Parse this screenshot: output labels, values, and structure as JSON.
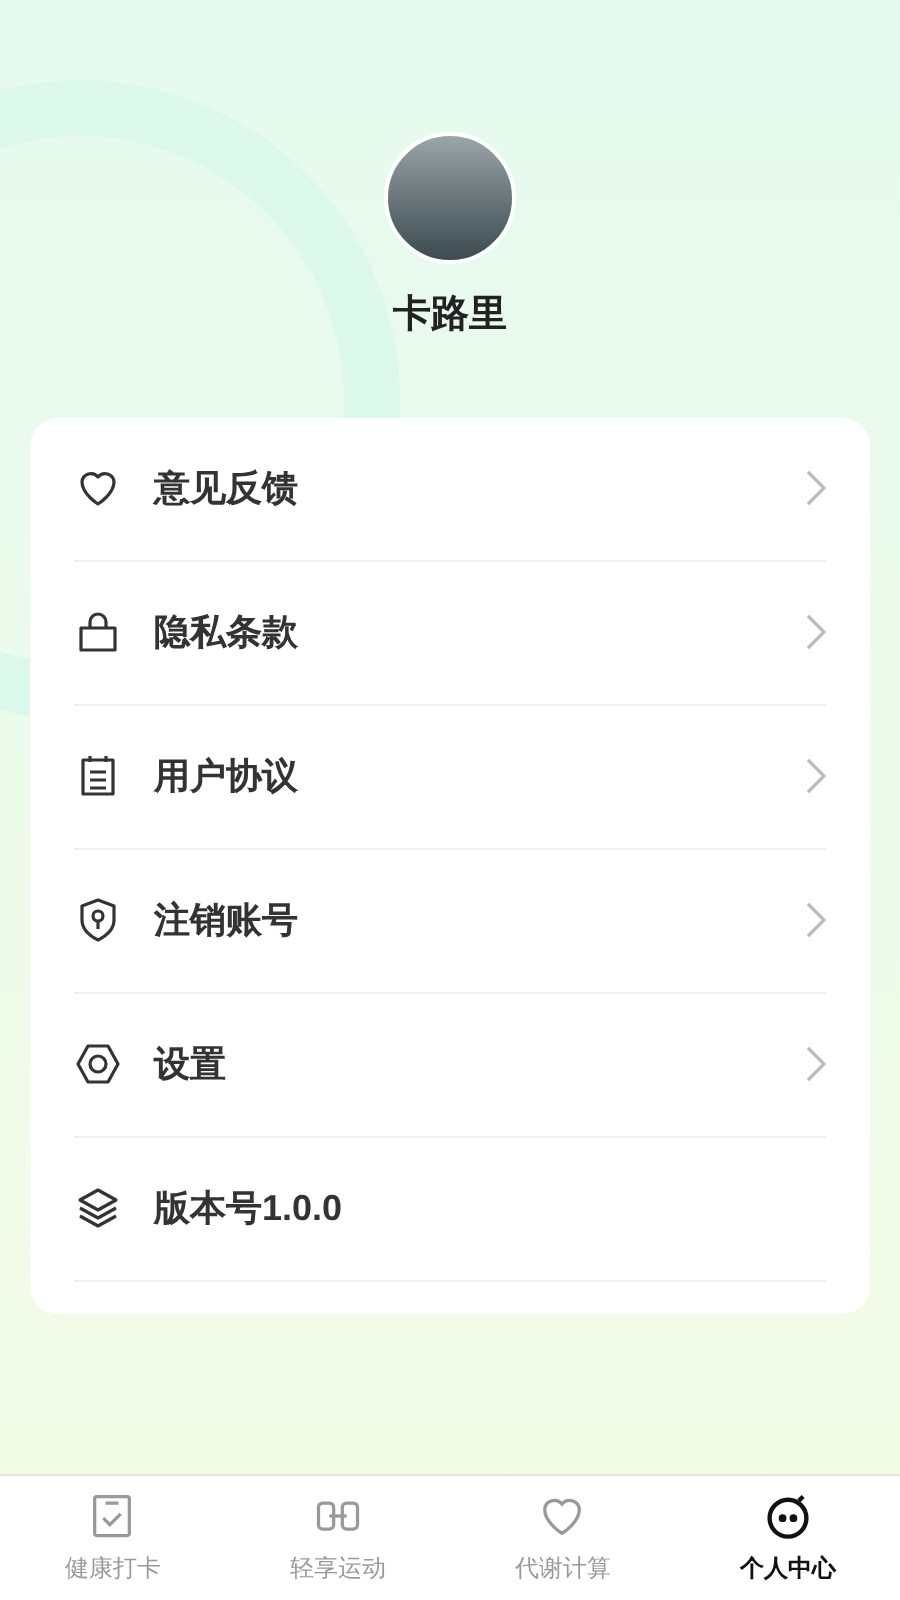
{
  "profile": {
    "name": "卡路里"
  },
  "menu": [
    {
      "label": "意见反馈",
      "kind": "link"
    },
    {
      "label": "隐私条款",
      "kind": "link"
    },
    {
      "label": "用户协议",
      "kind": "link"
    },
    {
      "label": "注销账号",
      "kind": "link"
    },
    {
      "label": "设置",
      "kind": "link"
    },
    {
      "label": "版本号1.0.0",
      "kind": "info"
    }
  ],
  "tabs": [
    {
      "label": "健康打卡",
      "selected": false
    },
    {
      "label": "轻享运动",
      "selected": false
    },
    {
      "label": "代谢计算",
      "selected": false
    },
    {
      "label": "个人中心",
      "selected": true
    }
  ]
}
